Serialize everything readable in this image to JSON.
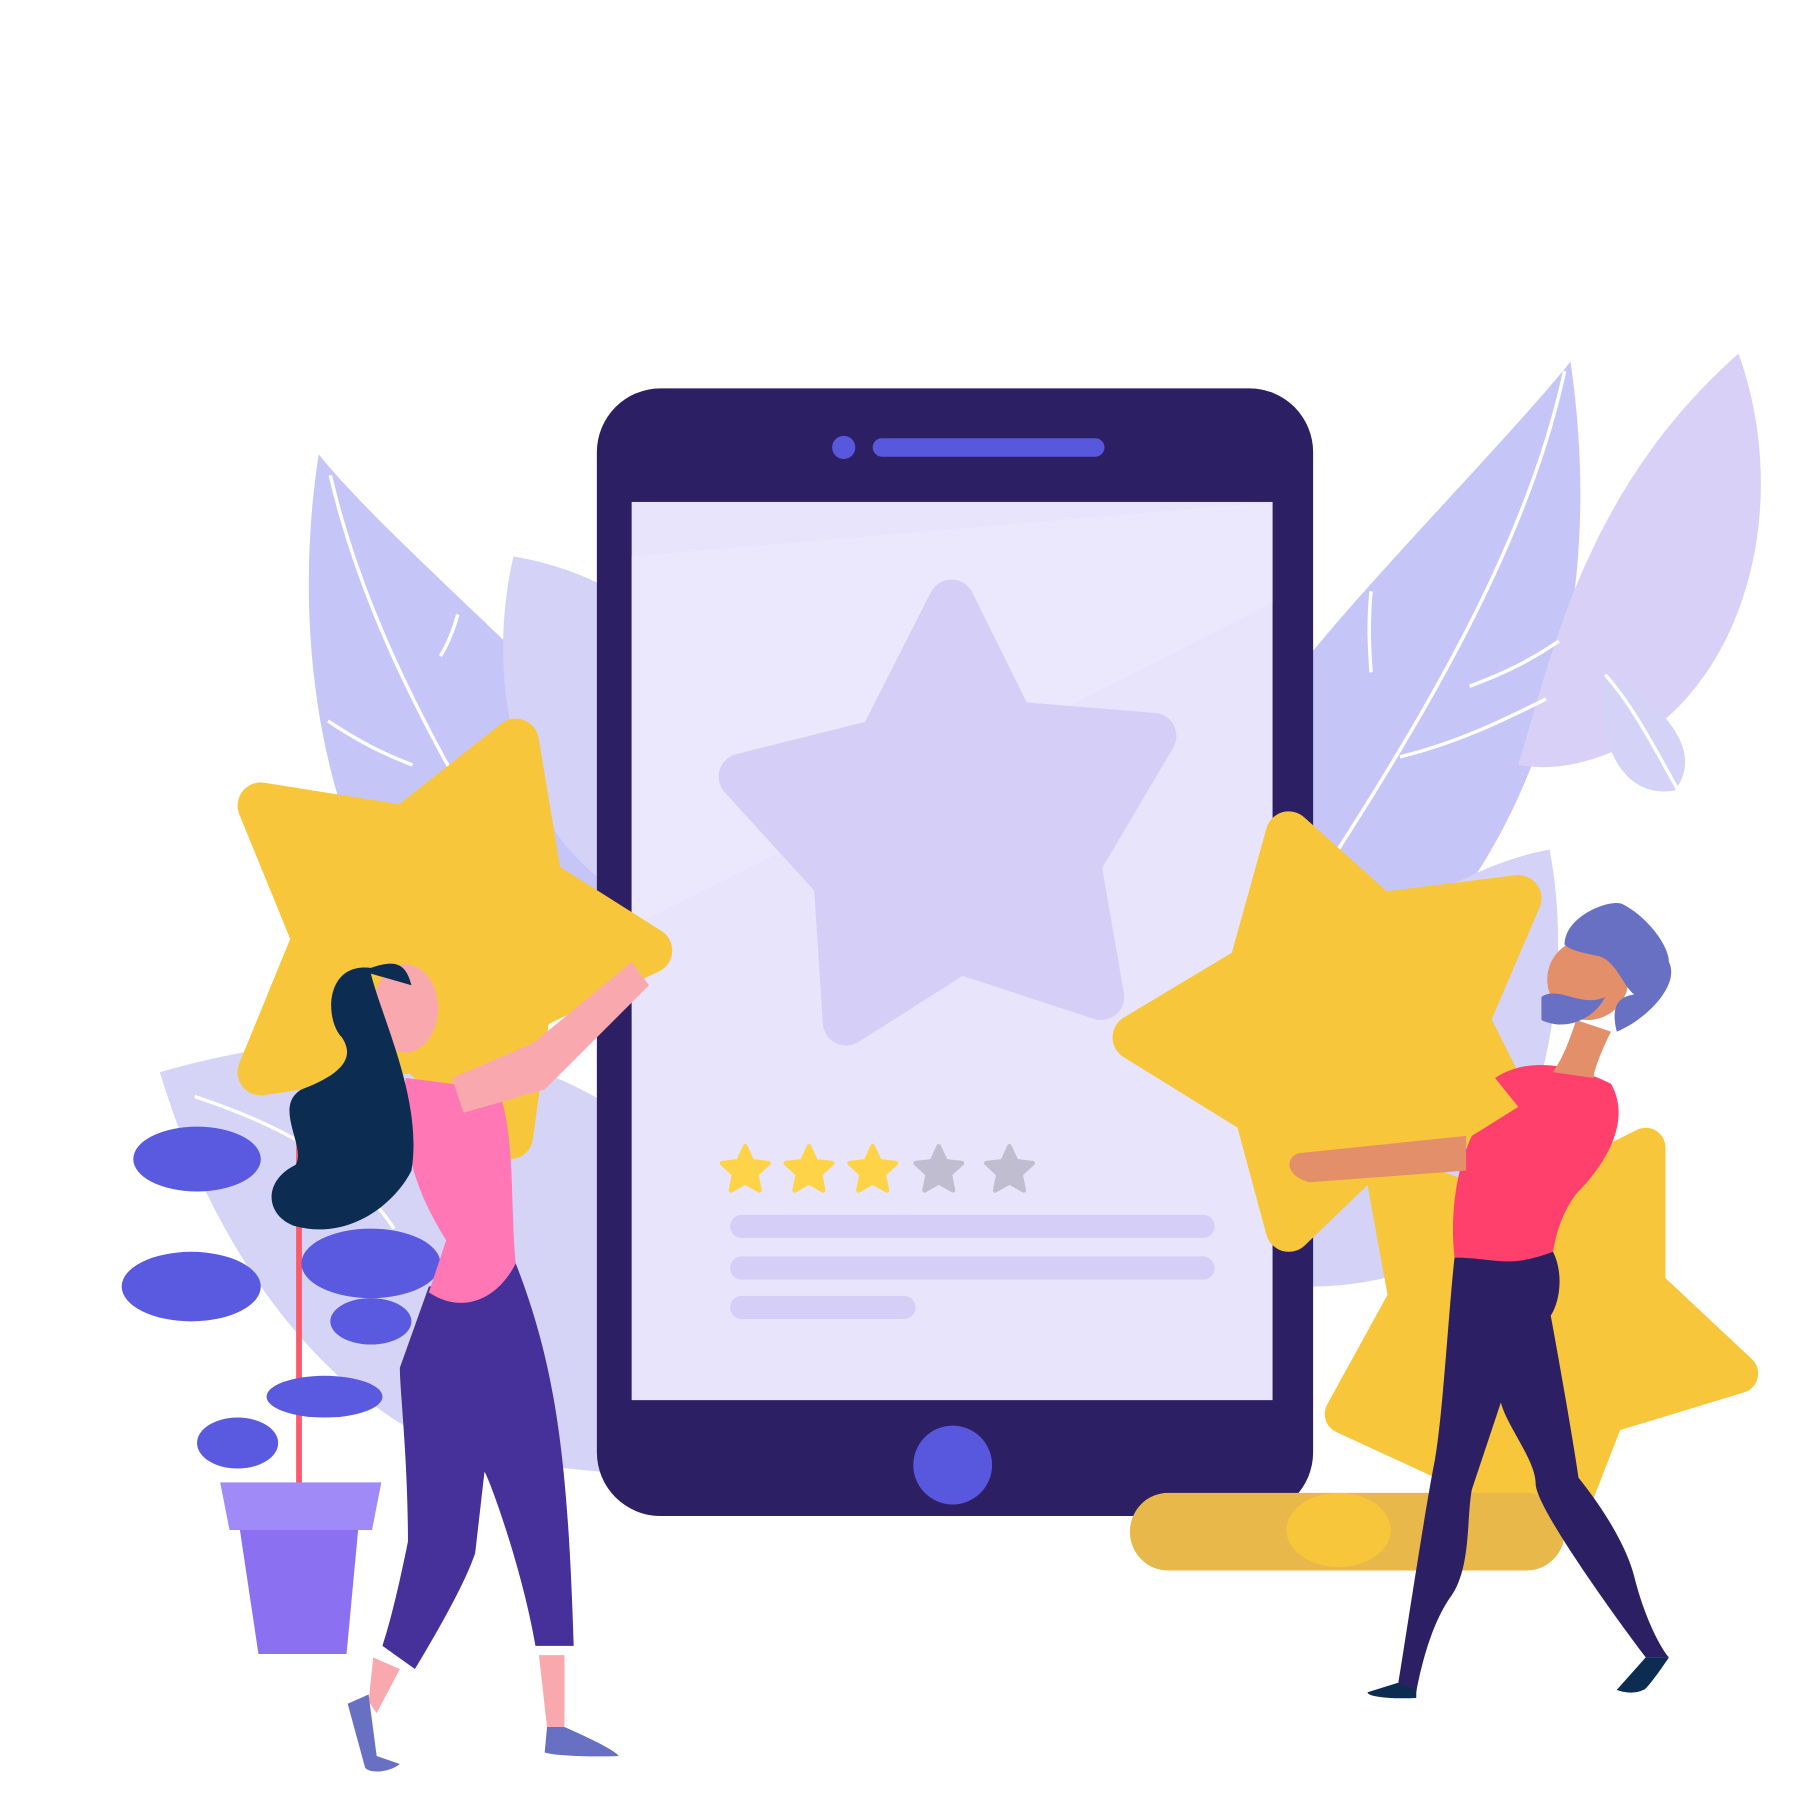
{
  "rating": {
    "value": 3,
    "max": 5
  },
  "colors": {
    "phone_body": "#2d1f63",
    "screen": "#e8e4fb",
    "accent": "#5858de",
    "star_gold": "#f8c63a",
    "star_gold_shadow": "#e2b34c",
    "star_filled": "#ffd347",
    "star_empty": "#c1bdd0",
    "leaf": "#c5c5f8",
    "leaf_light": "#d8d4f6",
    "woman_shirt": "#ff77b4",
    "woman_pants": "#46309a",
    "woman_hair": "#0c2c52",
    "man_shirt": "#ff3f6c",
    "man_pants": "#2d1f63",
    "man_hair": "#6870c4",
    "skin_light": "#f9a9ad",
    "skin_dark": "#e38f6a",
    "pot": "#8b70f2",
    "plant_leaf": "#5a5ae0"
  }
}
